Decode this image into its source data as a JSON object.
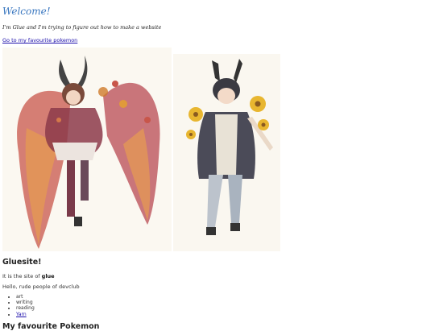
{
  "header": {
    "title": "Welcome!",
    "intro": "I'm Glue and I'm trying to figure out how to make a website",
    "fav_link": "Go to my favourite pokemon"
  },
  "images": [
    {
      "name": "winged-moth-character-painting"
    },
    {
      "name": "bunny-eared-character-with-flowers-painting"
    }
  ],
  "site": {
    "title": "Gluesite!",
    "line1_prefix": "It is the site of ",
    "line1_bold": "glue",
    "line2": "Hello, rude people of devclub",
    "hobbies": [
      "art",
      "writing",
      "reading"
    ],
    "hobby_link": "Yarn",
    "next_heading": "My favourite Pokemon"
  },
  "colors": {
    "title": "#3b78c0",
    "link": "#1a0dab"
  }
}
